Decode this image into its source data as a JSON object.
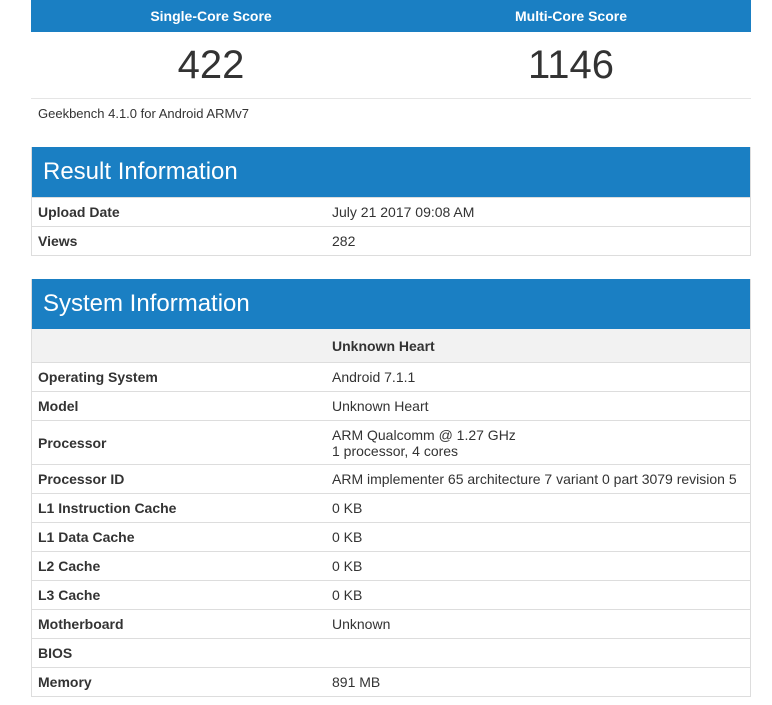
{
  "scores": {
    "single_label": "Single-Core Score",
    "multi_label": "Multi-Core Score",
    "single_value": "422",
    "multi_value": "1146",
    "version": "Geekbench 4.1.0 for Android ARMv7"
  },
  "result": {
    "title": "Result Information",
    "rows": [
      {
        "label": "Upload Date",
        "value": "July 21 2017 09:08 AM"
      },
      {
        "label": "Views",
        "value": "282"
      }
    ]
  },
  "system": {
    "title": "System Information",
    "device": "Unknown Heart",
    "rows": [
      {
        "label": "Operating System",
        "value": "Android 7.1.1"
      },
      {
        "label": "Model",
        "value": "Unknown Heart"
      },
      {
        "label": "Processor",
        "value": "ARM Qualcomm @ 1.27 GHz",
        "value2": "1 processor, 4 cores"
      },
      {
        "label": "Processor ID",
        "value": "ARM implementer 65 architecture 7 variant 0 part 3079 revision 5"
      },
      {
        "label": "L1 Instruction Cache",
        "value": "0 KB"
      },
      {
        "label": "L1 Data Cache",
        "value": "0 KB"
      },
      {
        "label": "L2 Cache",
        "value": "0 KB"
      },
      {
        "label": "L3 Cache",
        "value": "0 KB"
      },
      {
        "label": "Motherboard",
        "value": "Unknown"
      },
      {
        "label": "BIOS",
        "value": ""
      },
      {
        "label": "Memory",
        "value": "891 MB"
      }
    ]
  }
}
